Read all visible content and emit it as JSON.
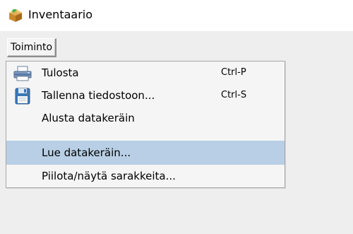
{
  "window": {
    "title": "Inventaario",
    "icon": "box-icon"
  },
  "menubar": {
    "menus": [
      {
        "label": "Toiminto",
        "open": true
      }
    ]
  },
  "dropdown": {
    "items": [
      {
        "label": "Tulosta",
        "shortcut": "Ctrl-P",
        "icon": "printer-icon",
        "selected": false
      },
      {
        "label": "Tallenna tiedostoon...",
        "shortcut": "Ctrl-S",
        "icon": "save-icon",
        "selected": false
      },
      {
        "label": "Alusta datakeräin",
        "shortcut": "",
        "icon": "",
        "selected": false
      },
      {
        "label": "Lue datakeräin...",
        "shortcut": "",
        "icon": "",
        "selected": true
      },
      {
        "label": "Piilota/näytä sarakkeita...",
        "shortcut": "",
        "icon": "",
        "selected": false
      }
    ]
  },
  "colors": {
    "selection": "#b8cfe5",
    "menu_background": "#f5f5f5",
    "window_background": "#eeeeee"
  }
}
